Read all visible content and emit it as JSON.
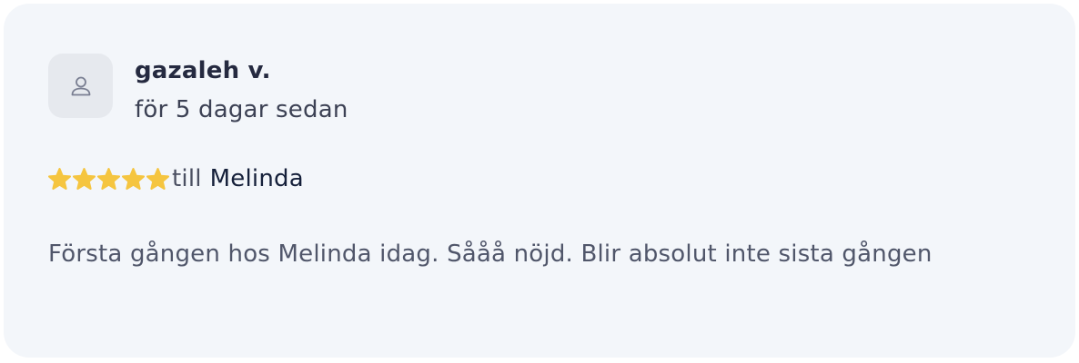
{
  "review": {
    "avatar_icon": "user-icon",
    "author": "gazaleh v.",
    "date": "för 5 dagar sedan",
    "rating": {
      "stars": 5,
      "max": 5,
      "star_color": "#f5c540",
      "label": "till",
      "staff_name": "Melinda"
    },
    "text": "Första gången hos Melinda idag. Sååå nöjd. Blir absolut inte sista gången"
  }
}
